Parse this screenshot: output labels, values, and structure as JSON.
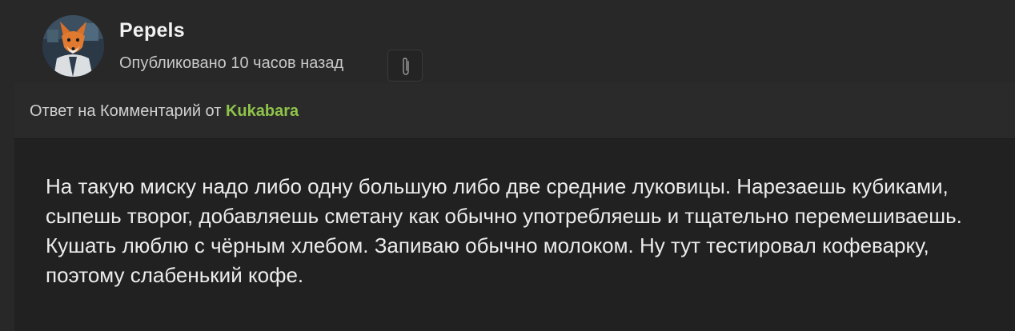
{
  "post": {
    "author": "Pepels",
    "published": "Опубликовано 10 часов назад",
    "attachment_icon": "paperclip-icon"
  },
  "reply": {
    "prefix": "Ответ на Комментарий от",
    "author": "Kukabara"
  },
  "comment": {
    "text": "На такую миску надо либо одну большую либо две средние луковицы. Нарезаешь кубиками, сыпешь творог, добавляешь сметану как обычно употребляешь и тщательно перемешиваешь. Кушать люблю с чёрным хлебом. Запиваю обычно молоком. Ну тут тестировал кофеварку, поэтому слабенький кофе."
  },
  "colors": {
    "background": "#282828",
    "card": "#212121",
    "reply_bar": "#2a2a2a",
    "accent_username": "#8fc34a"
  }
}
